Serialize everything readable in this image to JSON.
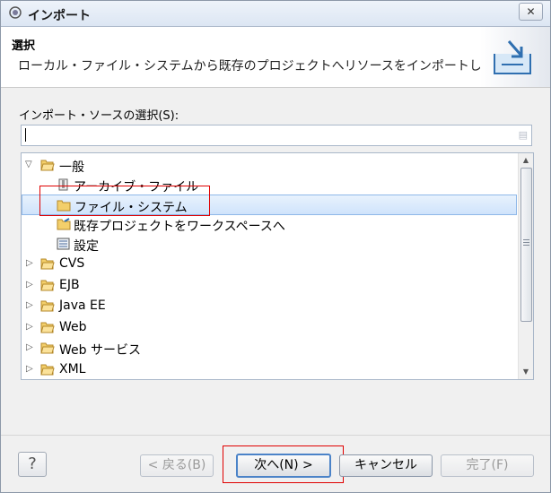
{
  "window": {
    "title": "インポート",
    "close_glyph": "✕"
  },
  "header": {
    "title": "選択",
    "description": "ローカル・ファイル・システムから既存のプロジェクトへリソースをインポートします。"
  },
  "source": {
    "label": "インポート・ソースの選択(S):",
    "filter_value": ""
  },
  "tree": {
    "items": [
      {
        "label": "一般",
        "expanded": true,
        "icon": "folder-open-icon"
      },
      {
        "label": "アーカイブ・ファイル",
        "icon": "archive-file-icon"
      },
      {
        "label": "ファイル・システム",
        "icon": "folder-icon",
        "selected": true
      },
      {
        "label": "既存プロジェクトをワークスペースへ",
        "icon": "project-folder-icon"
      },
      {
        "label": "設定",
        "icon": "preferences-icon"
      },
      {
        "label": "CVS",
        "expanded": false,
        "icon": "folder-icon"
      },
      {
        "label": "EJB",
        "expanded": false,
        "icon": "folder-icon"
      },
      {
        "label": "Java EE",
        "expanded": false,
        "icon": "folder-icon"
      },
      {
        "label": "Web",
        "expanded": false,
        "icon": "folder-icon"
      },
      {
        "label": "Web サービス",
        "expanded": false,
        "icon": "folder-icon"
      },
      {
        "label": "XML",
        "expanded": false,
        "icon": "folder-icon"
      }
    ]
  },
  "buttons": {
    "help": "?",
    "back": "< 戻る(B)",
    "next": "次へ(N) >",
    "cancel": "キャンセル",
    "finish": "完了(F)"
  },
  "colors": {
    "selection": "#cfe3fb",
    "highlight": "#e00000",
    "accent": "#4b83c8"
  }
}
